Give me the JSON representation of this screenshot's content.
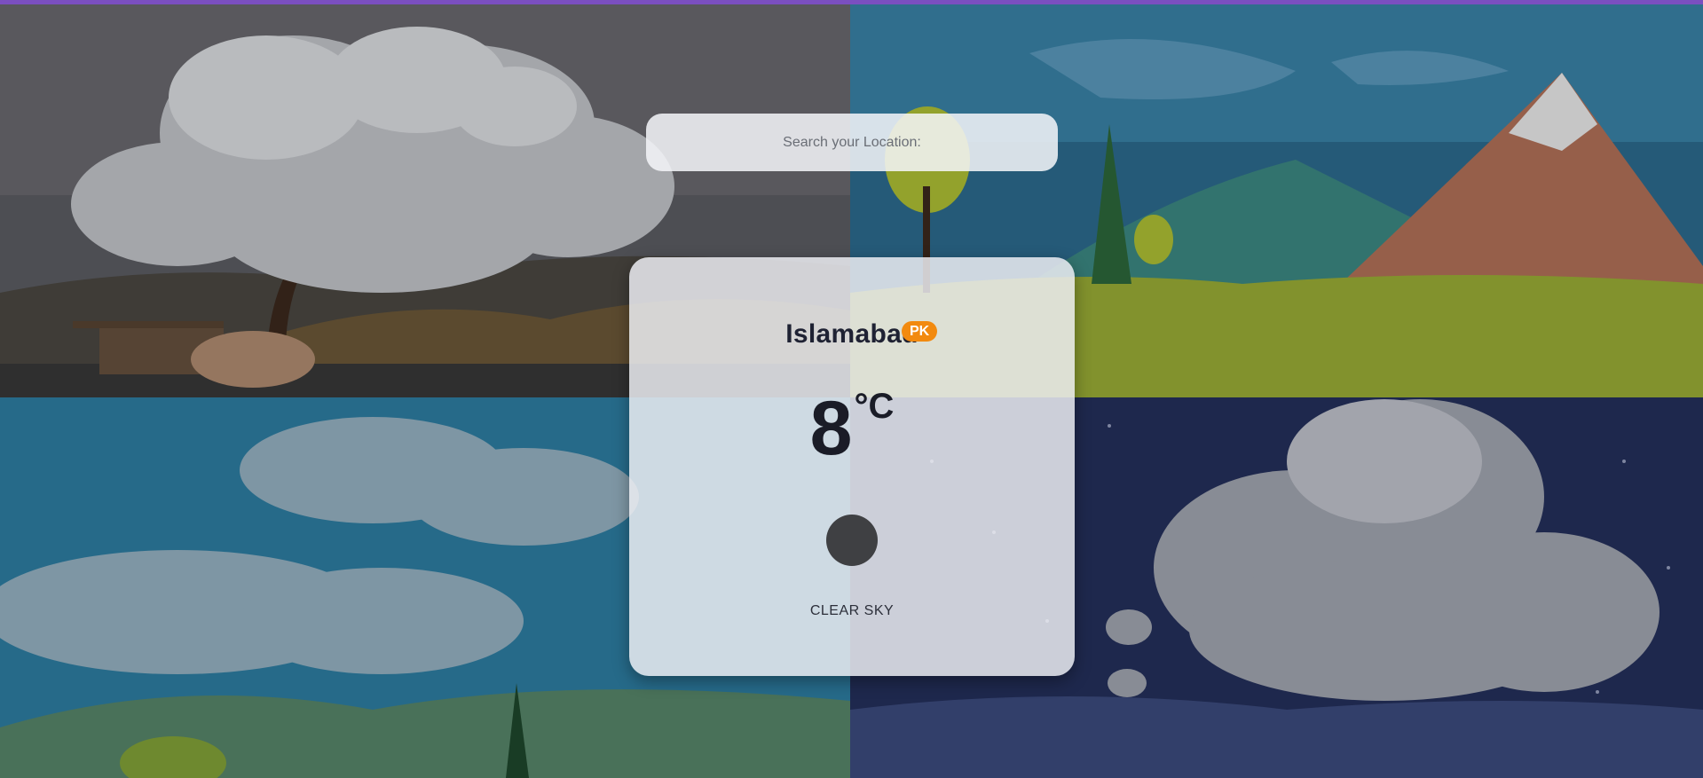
{
  "search": {
    "placeholder": "Search your Location:",
    "value": ""
  },
  "weather": {
    "city": "Islamabad",
    "country": "PK",
    "temperature": "8",
    "unit": "°C",
    "condition": "CLEAR SKY",
    "icon": "weather-condition-icon"
  },
  "theme": {
    "top_bar_color": "#7b4fc0",
    "badge_color": "#f28a0f"
  }
}
